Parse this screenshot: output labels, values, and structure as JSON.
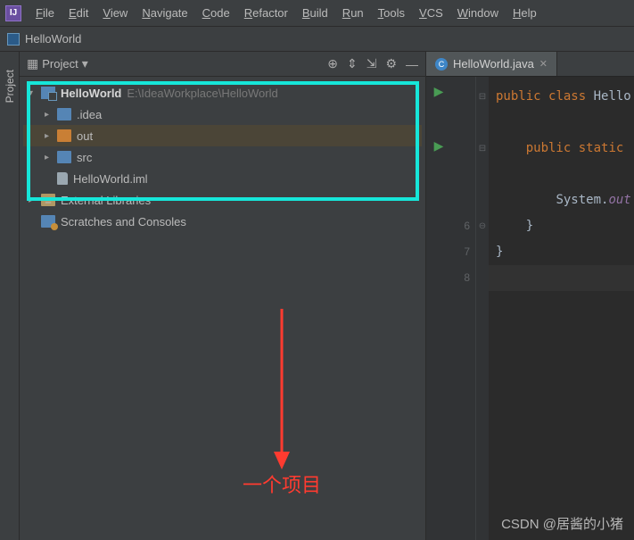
{
  "menu": {
    "items": [
      "File",
      "Edit",
      "View",
      "Navigate",
      "Code",
      "Refactor",
      "Build",
      "Run",
      "Tools",
      "VCS",
      "Window",
      "Help"
    ]
  },
  "breadcrumb": {
    "project": "HelloWorld"
  },
  "sidebar": {
    "label": "Project"
  },
  "project_panel": {
    "title": "Project",
    "root": {
      "name": "HelloWorld",
      "path": "E:\\IdeaWorkplace\\HelloWorld"
    },
    "children": [
      {
        "name": ".idea",
        "type": "folder-blue"
      },
      {
        "name": "out",
        "type": "folder-orange",
        "selected": true
      },
      {
        "name": "src",
        "type": "folder-blue"
      },
      {
        "name": "HelloWorld.iml",
        "type": "file-iml"
      }
    ],
    "external_libraries": "External Libraries",
    "scratches": "Scratches and Consoles"
  },
  "annotation": {
    "text": "一个项目"
  },
  "editor": {
    "tab_label": "HelloWorld.java",
    "visible_line_numbers": [
      "",
      "",
      "",
      "",
      "",
      "6",
      "7",
      "8"
    ],
    "code_lines": [
      {
        "tokens": [
          [
            "kw",
            "public "
          ],
          [
            "kw",
            "class "
          ],
          [
            "ident",
            "Hello"
          ]
        ]
      },
      {
        "tokens": []
      },
      {
        "tokens": [
          [
            "sp",
            "    "
          ],
          [
            "kw",
            "public "
          ],
          [
            "kw",
            "static "
          ]
        ]
      },
      {
        "tokens": []
      },
      {
        "tokens": [
          [
            "sp",
            "        "
          ],
          [
            "ident",
            "System."
          ],
          [
            "field",
            "out"
          ]
        ]
      },
      {
        "tokens": [
          [
            "sp",
            "    "
          ],
          [
            "ident",
            "}"
          ]
        ]
      },
      {
        "tokens": [
          [
            "ident",
            "}"
          ]
        ]
      },
      {
        "tokens": [],
        "current": true
      }
    ]
  },
  "watermark": "CSDN @居酱的小猪"
}
